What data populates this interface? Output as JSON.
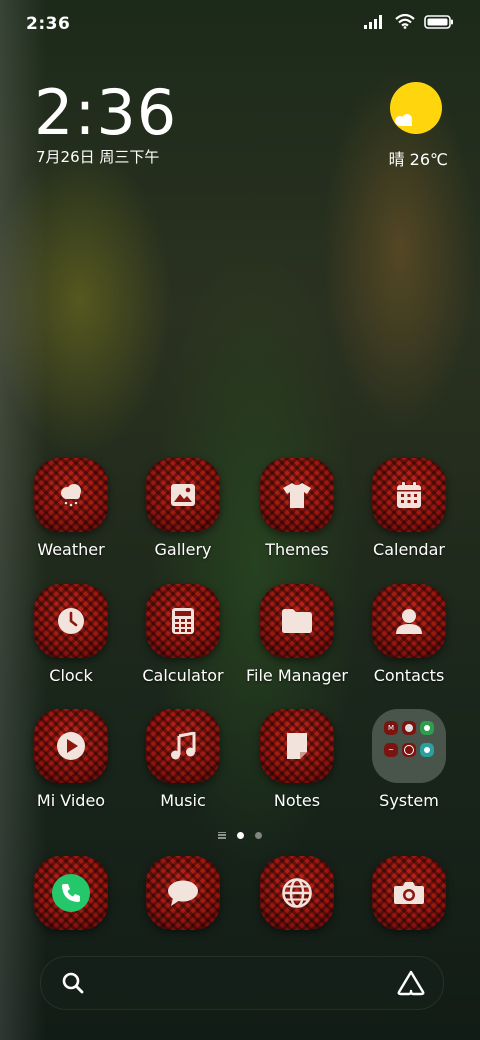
{
  "status_bar": {
    "time": "2:36",
    "icons": [
      "signal-icon",
      "wifi-icon",
      "battery-icon"
    ]
  },
  "clock_widget": {
    "time": "2:36",
    "date": "7月26日 周三下午"
  },
  "weather_widget": {
    "text": "晴 26℃",
    "icon": "sunny-cloud-icon"
  },
  "apps": [
    {
      "label": "Weather",
      "icon": "weather-icon"
    },
    {
      "label": "Gallery",
      "icon": "gallery-icon"
    },
    {
      "label": "Themes",
      "icon": "themes-icon"
    },
    {
      "label": "Calendar",
      "icon": "calendar-icon"
    },
    {
      "label": "Clock",
      "icon": "clock-icon"
    },
    {
      "label": "Calculator",
      "icon": "calculator-icon"
    },
    {
      "label": "File Manager",
      "icon": "folder-icon"
    },
    {
      "label": "Contacts",
      "icon": "contacts-icon"
    },
    {
      "label": "Mi Video",
      "icon": "play-icon"
    },
    {
      "label": "Music",
      "icon": "music-icon"
    },
    {
      "label": "Notes",
      "icon": "notes-icon"
    },
    {
      "label": "System",
      "icon": "folder-system-icon"
    }
  ],
  "page_indicator": {
    "pages": 2,
    "active_page": 1
  },
  "dock": [
    {
      "icon": "phone-icon"
    },
    {
      "icon": "messages-icon"
    },
    {
      "icon": "browser-icon"
    },
    {
      "icon": "camera-icon"
    }
  ],
  "search_bar": {
    "left_icon": "search-icon",
    "right_icon": "assistant-icon"
  },
  "colors": {
    "icon_red": "#9b1710",
    "sun_yellow": "#ffd60e",
    "phone_green": "#24c86b",
    "glyph": "#f2e3dc"
  }
}
